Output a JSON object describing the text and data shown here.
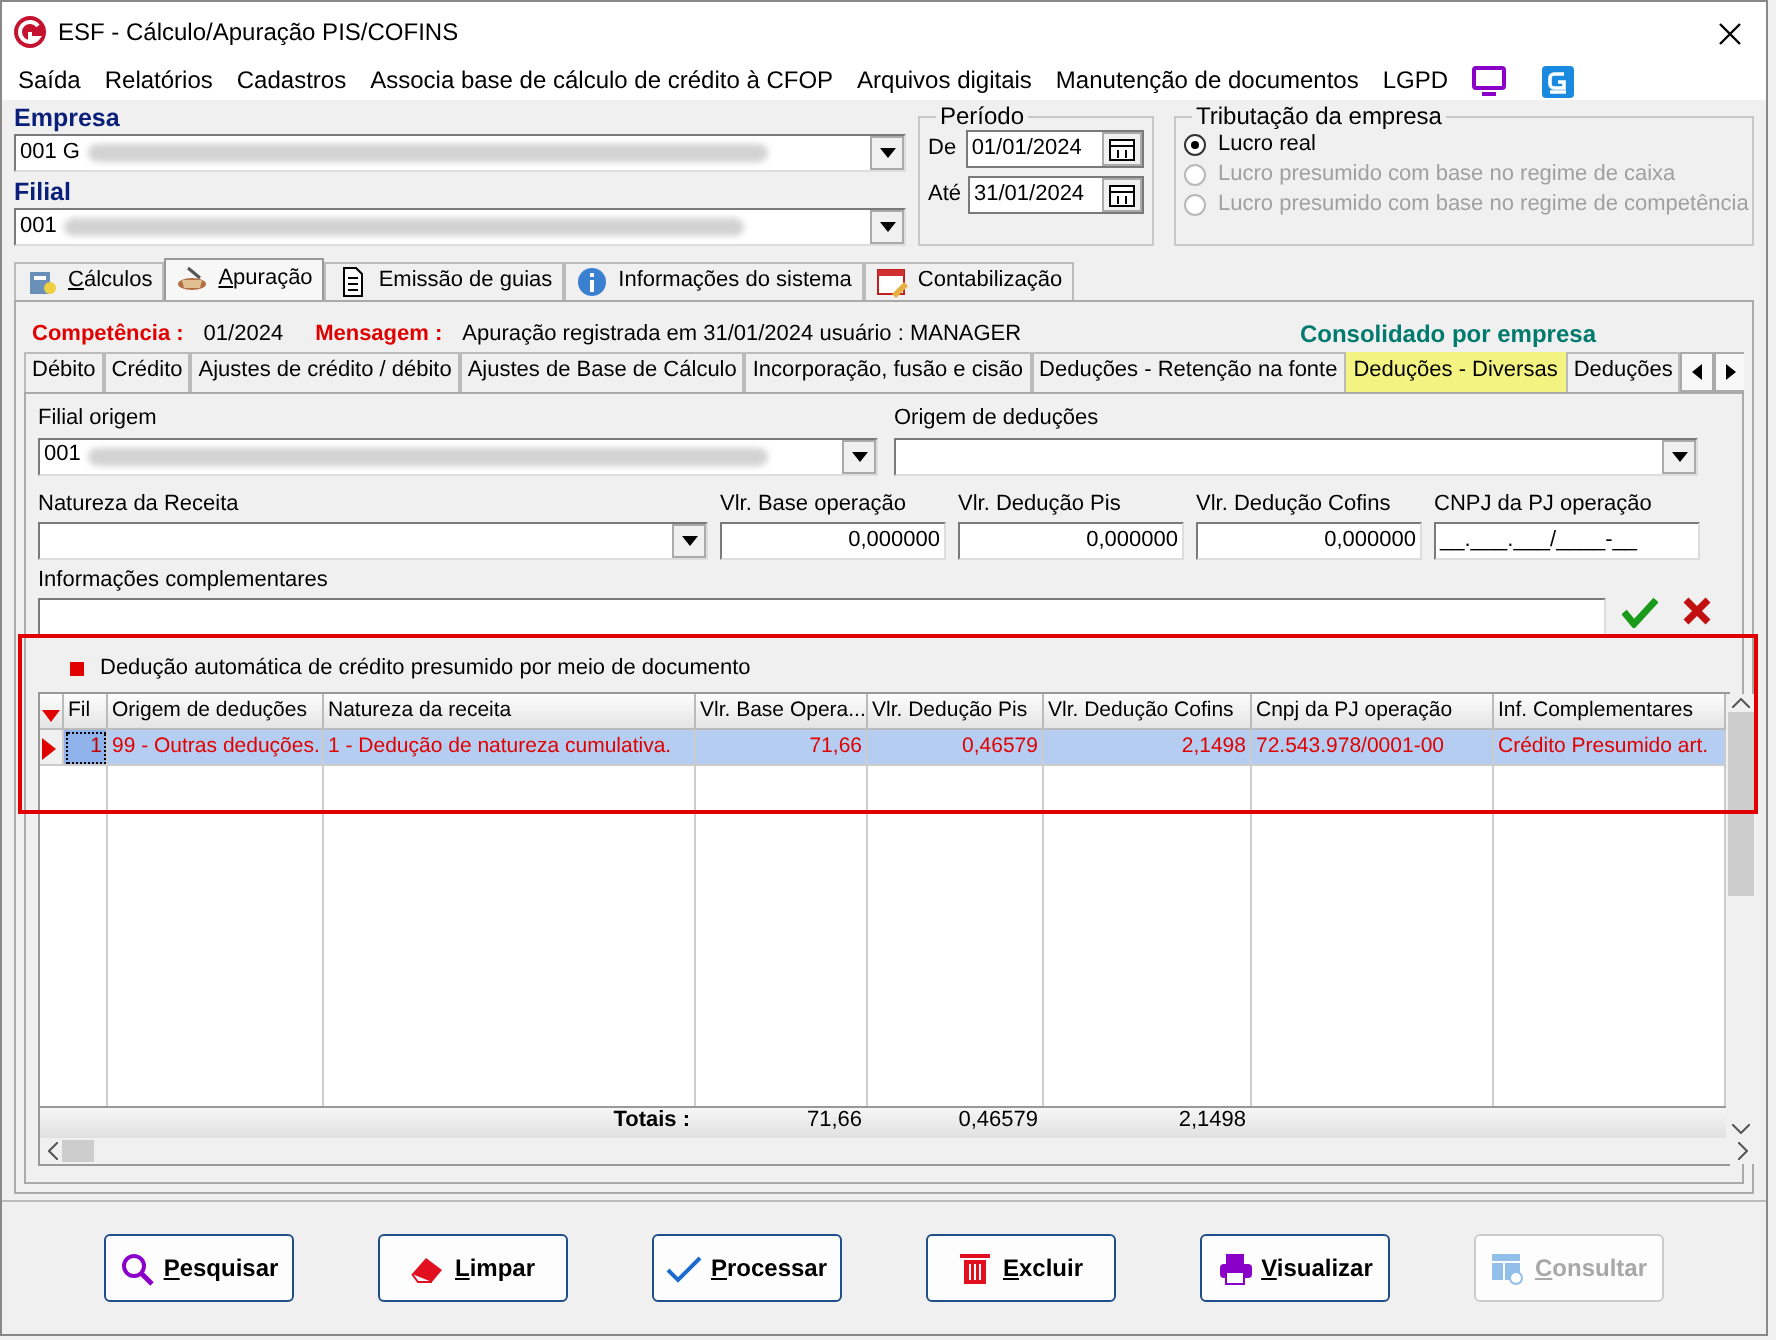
{
  "window": {
    "title": "ESF - Cálculo/Apuração PIS/COFINS"
  },
  "menu": [
    "Saída",
    "Relatórios",
    "Cadastros",
    "Associa base de cálculo de crédito à CFOP",
    "Arquivos digitais",
    "Manutenção de documentos",
    "LGPD"
  ],
  "empresa": {
    "label": "Empresa",
    "value": "001 G"
  },
  "filial": {
    "label": "Filial",
    "value": "001"
  },
  "periodo": {
    "title": "Período",
    "from_label": "De",
    "from": "01/01/2024",
    "to_label": "Até",
    "to": "31/01/2024"
  },
  "tributacao": {
    "title": "Tributação da empresa",
    "options": [
      {
        "label": "Lucro real",
        "selected": true,
        "disabled": false
      },
      {
        "label": "Lucro presumido com base no regime de caixa",
        "selected": false,
        "disabled": true
      },
      {
        "label": "Lucro presumido com base no regime de competência",
        "selected": false,
        "disabled": true
      }
    ]
  },
  "tabs": [
    {
      "label": "Cálculos",
      "kind": "calc",
      "selected": false,
      "mnemonic": true
    },
    {
      "label": "Apuração",
      "kind": "cup",
      "selected": true,
      "mnemonic": true
    },
    {
      "label": "Emissão de guias",
      "kind": "doc",
      "selected": false,
      "mnemonic": false
    },
    {
      "label": "Informações do sistema",
      "kind": "info",
      "selected": false,
      "mnemonic": false
    },
    {
      "label": "Contabilização",
      "kind": "cal",
      "selected": false,
      "mnemonic": false
    }
  ],
  "status": {
    "competencia_label": "Competência :",
    "competencia": "01/2024",
    "mensagem_label": "Mensagem :",
    "mensagem": "Apuração registrada em 31/01/2024 usuário : MANAGER",
    "consolidado": "Consolidado por empresa"
  },
  "subtabs": [
    {
      "label": "Débito",
      "selected": false
    },
    {
      "label": "Crédito",
      "selected": false
    },
    {
      "label": "Ajustes de crédito / débito",
      "selected": false
    },
    {
      "label": "Ajustes de Base de Cálculo",
      "selected": false
    },
    {
      "label": "Incorporação, fusão e cisão",
      "selected": false
    },
    {
      "label": "Deduções - Retenção na fonte",
      "selected": false
    },
    {
      "label": "Deduções - Diversas",
      "selected": true
    },
    {
      "label": "Deduções",
      "selected": false
    }
  ],
  "form": {
    "filial_origem": {
      "label": "Filial origem",
      "value": "001"
    },
    "origem": {
      "label": "Origem de deduções"
    },
    "natureza": {
      "label": "Natureza da Receita"
    },
    "vlr_base": {
      "label": "Vlr. Base operação",
      "value": "0,000000"
    },
    "vlr_pis": {
      "label": "Vlr. Dedução  Pis",
      "value": "0,000000"
    },
    "vlr_cofins": {
      "label": "Vlr. Dedução Cofins",
      "value": "0,000000"
    },
    "cnpj": {
      "label": "CNPJ da PJ operação",
      "value": "__.___.___/____-__"
    },
    "info": {
      "label": "Informações complementares"
    }
  },
  "auto_deduction": {
    "label": "Dedução automática de crédito presumido por meio de documento"
  },
  "table": {
    "columns": [
      "Fil",
      "Origem de deduções",
      "Natureza da receita",
      "Vlr. Base Opera...",
      "Vlr. Dedução Pis",
      "Vlr. Dedução Cofins",
      "Cnpj da PJ operação",
      "Inf. Complementares"
    ],
    "rows": [
      {
        "selected": true,
        "cells": [
          "1",
          "99 - Outras deduções.",
          "1 - Dedução de natureza cumulativa.",
          "71,66",
          "0,46579",
          "2,1498",
          "72.543.978/0001-00",
          "Crédito Presumido art."
        ]
      }
    ],
    "totals_label": "Totais :",
    "totals": [
      "71,66",
      "0,46579",
      "2,1498"
    ]
  },
  "buttons": [
    {
      "label": "Pesquisar",
      "kind": "search",
      "disabled": false
    },
    {
      "label": "Limpar",
      "kind": "eraser",
      "disabled": false
    },
    {
      "label": "Processar",
      "kind": "check",
      "disabled": false
    },
    {
      "label": "Excluir",
      "kind": "trash",
      "disabled": false
    },
    {
      "label": "Visualizar",
      "kind": "print",
      "disabled": false
    },
    {
      "label": "Consultar",
      "kind": "table",
      "disabled": true
    }
  ]
}
